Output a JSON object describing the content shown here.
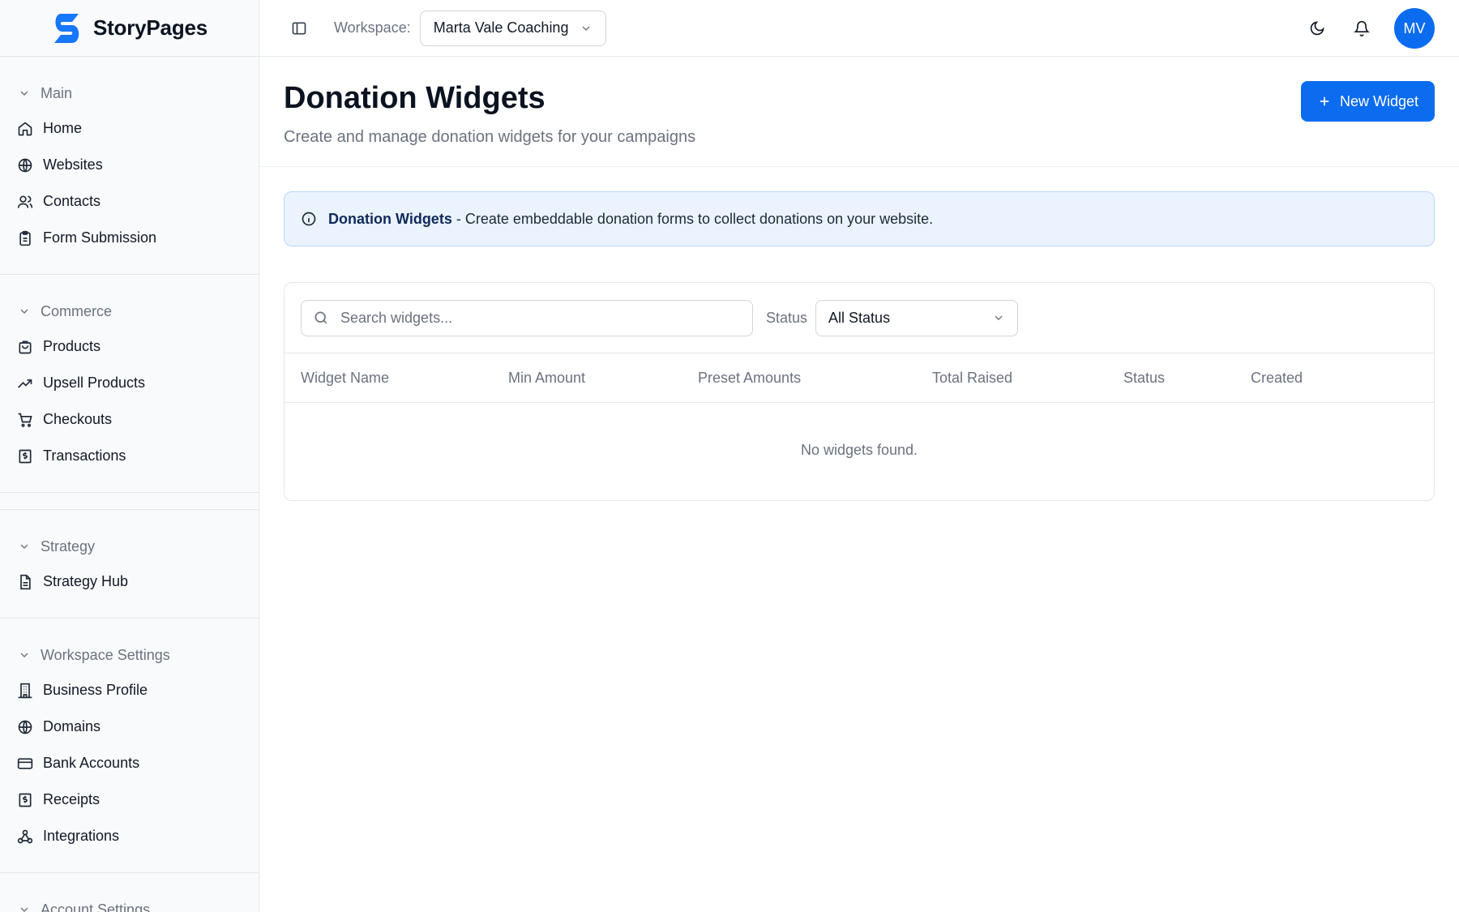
{
  "brand": {
    "name": "StoryPages"
  },
  "sidebar": {
    "groups": [
      {
        "label": "Main",
        "items": [
          {
            "label": "Home",
            "icon": "home-icon"
          },
          {
            "label": "Websites",
            "icon": "globe-icon"
          },
          {
            "label": "Contacts",
            "icon": "users-icon"
          },
          {
            "label": "Form Submission",
            "icon": "clipboard-icon"
          }
        ]
      },
      {
        "label": "Commerce",
        "items": [
          {
            "label": "Products",
            "icon": "shopping-bag-icon"
          },
          {
            "label": "Upsell Products",
            "icon": "trending-up-icon"
          },
          {
            "label": "Checkouts",
            "icon": "cart-icon"
          },
          {
            "label": "Transactions",
            "icon": "receipt-icon"
          }
        ]
      },
      {
        "label": "Strategy",
        "items": [
          {
            "label": "Strategy Hub",
            "icon": "document-icon"
          }
        ]
      },
      {
        "label": "Workspace Settings",
        "items": [
          {
            "label": "Business Profile",
            "icon": "building-icon"
          },
          {
            "label": "Domains",
            "icon": "globe-icon"
          },
          {
            "label": "Bank Accounts",
            "icon": "credit-card-icon"
          },
          {
            "label": "Receipts",
            "icon": "receipt-icon"
          },
          {
            "label": "Integrations",
            "icon": "webhook-icon"
          }
        ]
      },
      {
        "label": "Account Settings",
        "items": []
      }
    ]
  },
  "header": {
    "workspace_label": "Workspace:",
    "workspace_value": "Marta Vale Coaching",
    "avatar_initials": "MV"
  },
  "page": {
    "title": "Donation Widgets",
    "subtitle": "Create and manage donation widgets for your campaigns",
    "new_button": "New Widget"
  },
  "info": {
    "title": "Donation Widgets",
    "text": " - Create embeddable donation forms to collect donations on your website."
  },
  "filters": {
    "search_placeholder": "Search widgets...",
    "status_label": "Status",
    "status_value": "All Status"
  },
  "table": {
    "columns": [
      "Widget Name",
      "Min Amount",
      "Preset Amounts",
      "Total Raised",
      "Status",
      "Created"
    ],
    "empty_text": "No widgets found."
  },
  "colors": {
    "accent": "#0b6cf0",
    "info_bg": "#eaf3fe",
    "info_border": "#b9d8fb"
  }
}
